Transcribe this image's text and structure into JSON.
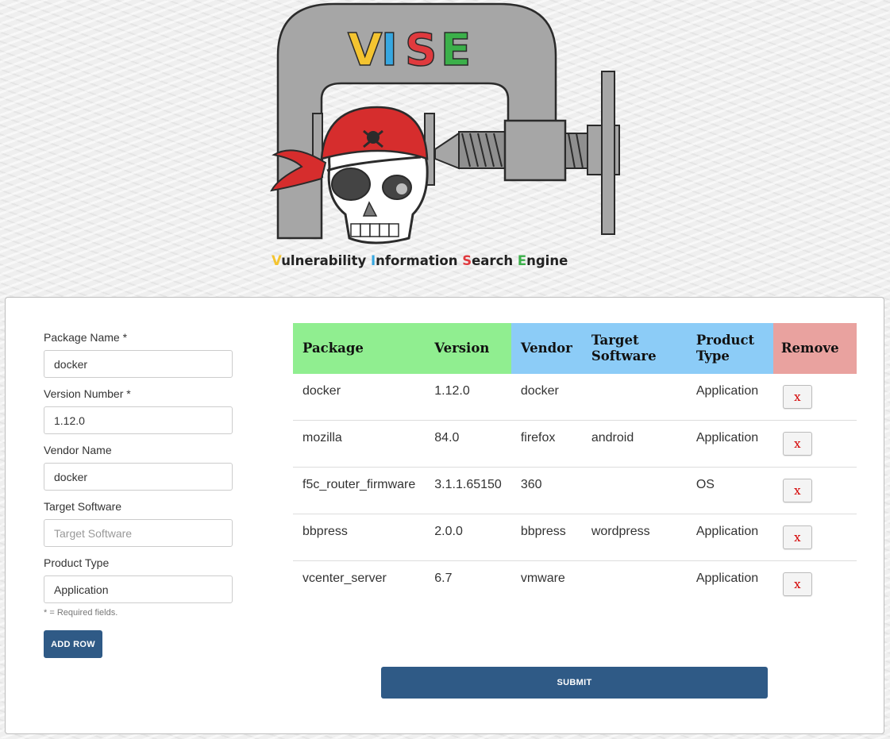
{
  "logo": {
    "title": "VISE",
    "tagline": "Vulnerability Information Search Engine",
    "colors": {
      "v": "#f4c430",
      "i": "#37a7e0",
      "s": "#e03a3e",
      "e": "#3bb04a"
    }
  },
  "form": {
    "package_name": {
      "label": "Package Name *",
      "value": "docker",
      "placeholder": "Package Name"
    },
    "version_number": {
      "label": "Version Number *",
      "value": "1.12.0",
      "placeholder": "Version Number"
    },
    "vendor_name": {
      "label": "Vendor Name",
      "value": "docker",
      "placeholder": "Vendor Name"
    },
    "target_software": {
      "label": "Target Software",
      "value": "",
      "placeholder": "Target Software"
    },
    "product_type": {
      "label": "Product Type",
      "value": "Application",
      "placeholder": "Product Type"
    },
    "required_note": "* = Required fields.",
    "add_row_label": "ADD ROW"
  },
  "table": {
    "headers": {
      "package": "Package",
      "version": "Version",
      "vendor": "Vendor",
      "target_software": "Target Software",
      "product_type": "Product Type",
      "remove": "Remove"
    },
    "rows": [
      {
        "package": "docker",
        "version": "1.12.0",
        "vendor": "docker",
        "target_software": "",
        "product_type": "Application",
        "remove": "x"
      },
      {
        "package": "mozilla",
        "version": "84.0",
        "vendor": "firefox",
        "target_software": "android",
        "product_type": "Application",
        "remove": "x"
      },
      {
        "package": "f5c_router_firmware",
        "version": "3.1.1.65150",
        "vendor": "360",
        "target_software": "",
        "product_type": "OS",
        "remove": "x"
      },
      {
        "package": "bbpress",
        "version": "2.0.0",
        "vendor": "bbpress",
        "target_software": "wordpress",
        "product_type": "Application",
        "remove": "x"
      },
      {
        "package": "vcenter_server",
        "version": "6.7",
        "vendor": "vmware",
        "target_software": "",
        "product_type": "Application",
        "remove": "x"
      }
    ]
  },
  "submit_label": "SUBMIT"
}
